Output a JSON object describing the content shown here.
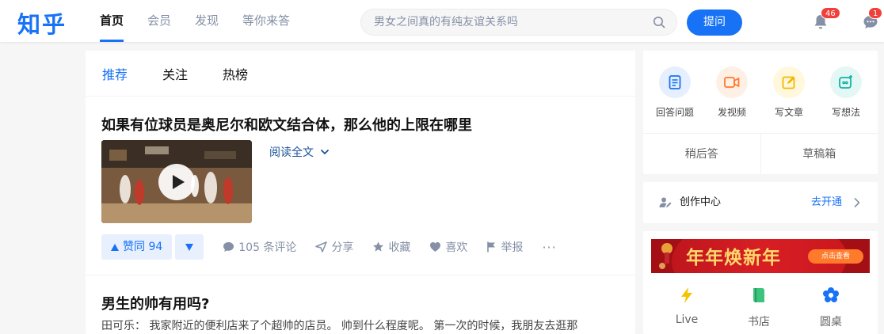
{
  "header": {
    "logo": "知乎",
    "nav": [
      "首页",
      "会员",
      "发现",
      "等你来答"
    ],
    "search_placeholder": "男女之间真的有纯友谊关系吗",
    "ask_label": "提问",
    "notifications_count": "46",
    "messages_count": "1"
  },
  "feed": {
    "tabs": [
      "推荐",
      "关注",
      "热榜"
    ],
    "cards": [
      {
        "title": "如果有位球员是奥尼尔和欧文结合体，那么他的上限在哪里",
        "read_more": "阅读全文",
        "upvote_label": "赞同 94",
        "actions": {
          "comments": "105 条评论",
          "share": "分享",
          "collect": "收藏",
          "like": "喜欢",
          "report": "举报",
          "more": "···"
        }
      },
      {
        "title": "男生的帅有用吗?",
        "excerpt": "田可乐： 我家附近的便利店来了个超帅的店员。 帅到什么程度呢。 第一次的时候，我朋友去逛那"
      }
    ]
  },
  "sidebar": {
    "creator_tools": [
      "回答问题",
      "发视频",
      "写文章",
      "写想法"
    ],
    "bottom_links": [
      "稍后答",
      "草稿箱"
    ],
    "creation_center": {
      "label": "创作中心",
      "link": "去开通"
    },
    "banner_text": "年年焕新年",
    "banner_button": "点击查看",
    "shortcuts": [
      "Live",
      "书店",
      "圆桌"
    ]
  },
  "colors": {
    "brand": "#1772f6",
    "badge": "#f1403c",
    "banner": "#d81e25"
  }
}
